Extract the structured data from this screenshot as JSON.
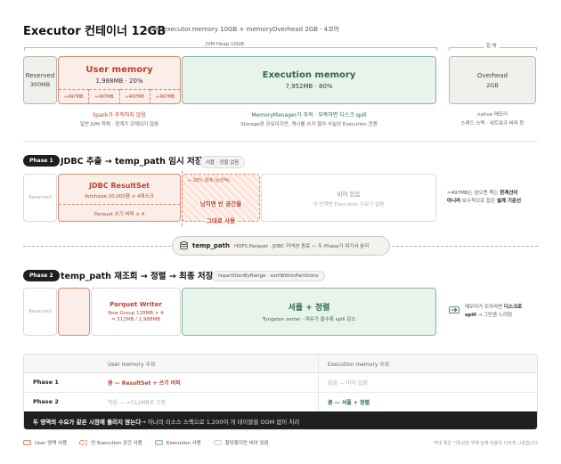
{
  "header": {
    "title": "Executor 컨테이너 12GB",
    "subtitle": "spark.executor.memory 10GB + memoryOverhead 2GB · 4코어"
  },
  "top": {
    "heap_label": "JVM Heap 10GB",
    "offheap_label": "힙 밖",
    "reserved": {
      "title": "Reserved",
      "value": "300MB"
    },
    "user": {
      "title": "User memory",
      "value": "1,988MB · 20%",
      "slots": [
        "≈497MB",
        "≈497MB",
        "≈497MB",
        "≈497MB"
      ]
    },
    "execution": {
      "title": "Execution memory",
      "value": "7,952MB · 80%"
    },
    "overhead": {
      "title": "Overhead",
      "value": "2GB"
    },
    "user_note": {
      "line1": "Spark가 추적하지 않음",
      "line2": "일반 JVM 객체 · 경계가 강제되지 않음"
    },
    "exec_note": {
      "line1": "MemoryManager가 추적 · 부족하면 디스크 spill",
      "line2": "Storage와 공유이지만, 캐시를 쓰지 않아 사실상 Execution 전용"
    },
    "over_note": {
      "line1": "native 메모리",
      "line2": "스레드 스택 · 네트워크 버퍼 등"
    }
  },
  "phase1": {
    "badge": "Phase 1",
    "title": "JDBC 추출 → temp_path 임시 저장",
    "tag": "셔플 · 정렬 없음",
    "reserved": "Reserved",
    "result_title": "JDBC ResultSet",
    "result_sub": "fetchsize 20,000행 × 4태스크",
    "parquet_buf": "Parquet 쓰기 버퍼 × 4",
    "boundary": "← 20% 경계 (논리적)",
    "overflow_line1": "남치면 빈 공간을",
    "overflow_line2": "그대로 사용",
    "empty_title": "비어 있음",
    "empty_sub": "이 단계엔 Execution 수요가 없음",
    "side_l1a": "≈497MB는 넘으면 죽는 ",
    "side_l1b": "한계선이",
    "side_l2a": "아니라",
    "side_l2b": " 보수적으로 잡은 ",
    "side_l2c": "설계 기준선"
  },
  "temp": {
    "icon": "database-icon",
    "name": "temp_path",
    "desc": "HDFS Parquet · JDBC 커넥션 종료 — 두 Phase가 여기서 분리"
  },
  "phase2": {
    "badge": "Phase 2",
    "title": "temp_path 재조회 → 정렬 → 최종 저장",
    "tag": "repartitionByRange · sortWithinPartitions",
    "reserved": "Reserved",
    "writer_title": "Parquet Writer",
    "writer_l1": "Row Group 128MB × 4",
    "writer_l2": "= 512MB / 1,988MB",
    "exec_title": "셔플 + 정렬",
    "exec_sub": "Tungsten sorter · 여유가 클수록 spill 감소",
    "side_l1a": "메모리가 모자라면 ",
    "side_l1b": "디스크로",
    "side_l2a": "spill",
    "side_l2b": " → 그만큼 느려짐"
  },
  "table": {
    "headers": [
      "",
      "User memory 수요",
      "Execution memory 수요"
    ],
    "rows": [
      {
        "phase": "Phase 1",
        "user": "큼 — ResultSet + 쓰기 버퍼",
        "exec": "없음 — 비어 있음"
      },
      {
        "phase": "Phase 2",
        "user": "작음 — ≈512MB로 고정",
        "exec": "큼 — 셔플 + 정렬"
      }
    ],
    "footer_bold": "두 영역의 수요가 같은 시점에 몰리지 않는다",
    "footer_rest": " → 하나의 리소스 스펙으로 1,200여 개 테이블을 OOM 없이 처리"
  },
  "legend": {
    "items": [
      "User 영역 사용",
      "빈 Execution 공간 사용",
      "Execution 사용",
      "할당됐지만 비어 있음"
    ],
    "note": "막대 폭은 가독성을 위해 실제 비율과 다르게 그렸습니다"
  },
  "colors": {
    "user_fill": "#fbeee8",
    "user_border": "#d98b72",
    "user_text": "#b8432a",
    "exec_fill": "#e8f3ec",
    "exec_border": "#86b79a",
    "exec_text": "#2e6b47",
    "reserved_fill": "#f1efec",
    "dark": "#1f1f1f"
  }
}
